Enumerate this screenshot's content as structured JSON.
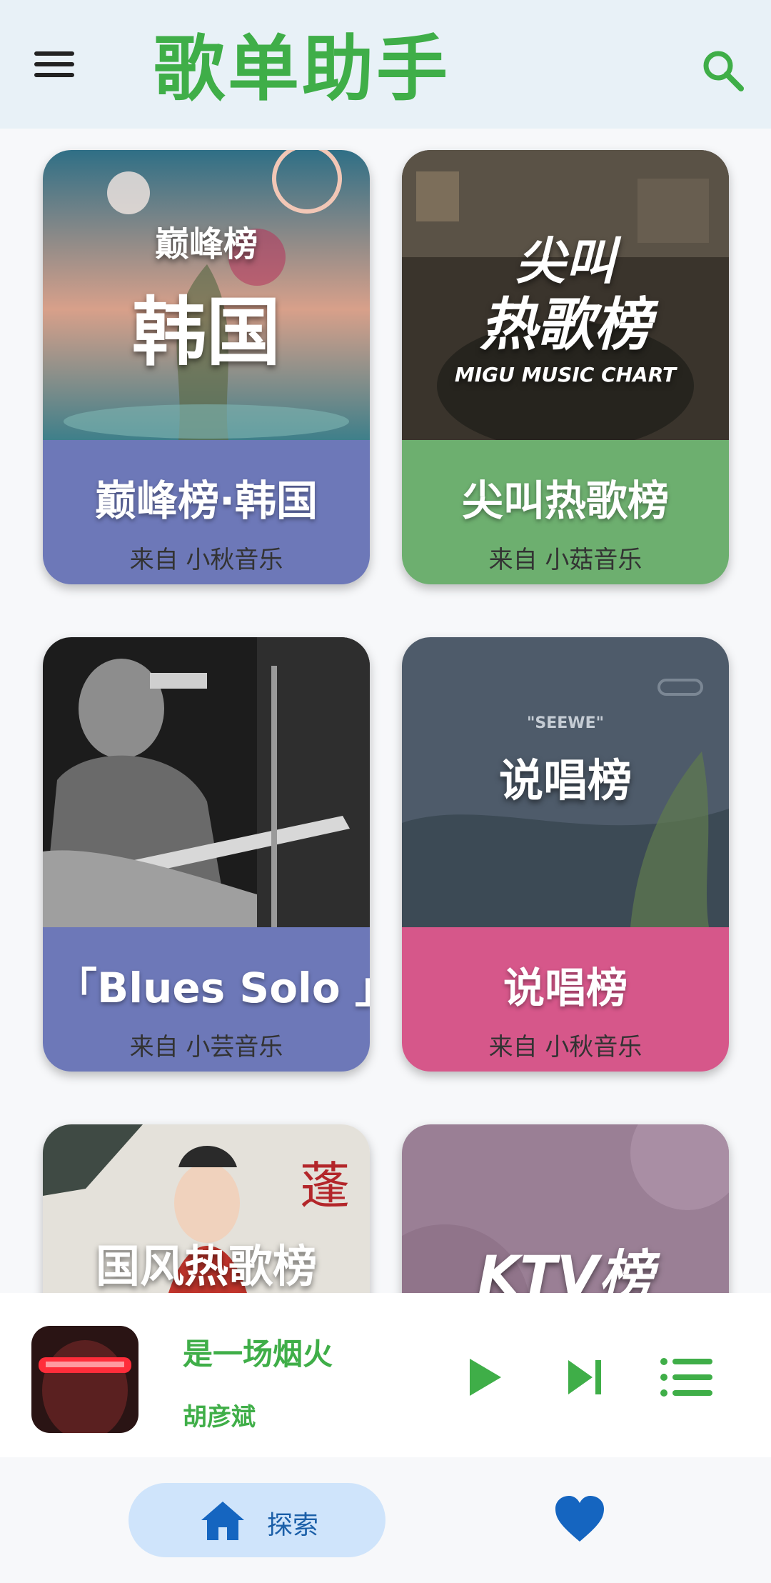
{
  "app": {
    "title": "歌单助手",
    "accent": "#3fae48"
  },
  "playlists": [
    {
      "cover_tag": "巅峰榜",
      "cover_text": "韩国",
      "title": "巅峰榜·韩国",
      "source": "来自 小秋音乐",
      "info_color": "#6d78b8"
    },
    {
      "cover_text": "尖叫",
      "cover_text2": "热歌榜",
      "cover_sub": "MIGU MUSIC CHART",
      "title": "尖叫热歌榜",
      "source": "来自 小菇音乐",
      "info_color": "#6daf6f"
    },
    {
      "title": "「Blues Solo 」精",
      "source": "来自 小芸音乐",
      "info_color": "#6d78b8"
    },
    {
      "cover_tag": "\"SEEWE\"",
      "cover_text": "说唱榜",
      "title": "说唱榜",
      "source": "来自 小秋音乐",
      "info_color": "#d6578a"
    },
    {
      "cover_text": "国风热歌榜"
    },
    {
      "cover_text": "KTV榜"
    }
  ],
  "player": {
    "song": "是一场烟火",
    "artist": "胡彦斌"
  },
  "nav": {
    "explore_label": "探索"
  }
}
